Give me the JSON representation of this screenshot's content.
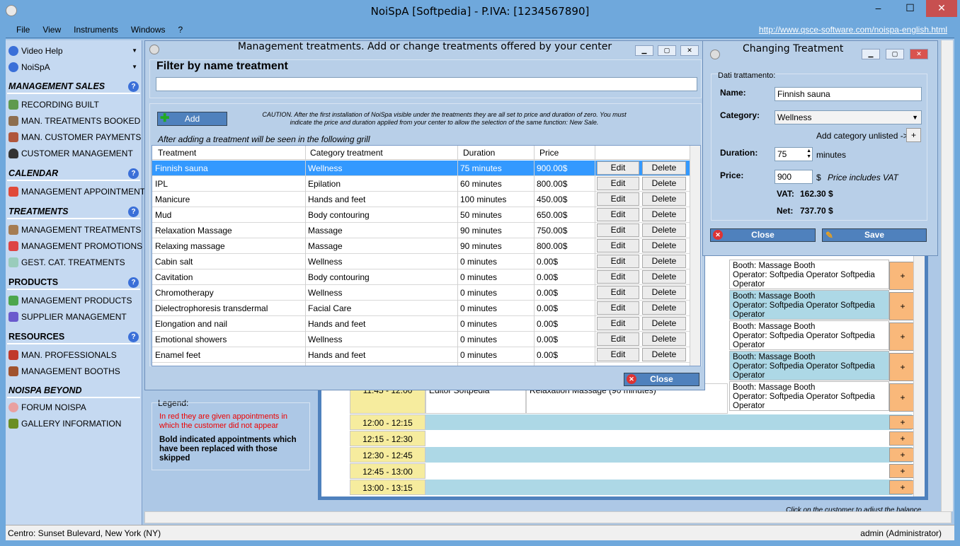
{
  "app": {
    "title": "NoiSpA  [Softpedia] - P.IVA: [1234567890]",
    "menu": [
      "File",
      "View",
      "Instruments",
      "Windows",
      "?"
    ],
    "url": "http://www.qsce-software.com/noispa-english.html",
    "min": "–",
    "max": "☐",
    "close": "✕"
  },
  "sidebar": {
    "top": [
      {
        "label": "Video Help"
      },
      {
        "label": "NoiSpA"
      }
    ],
    "sections": [
      {
        "title": "MANAGEMENT SALES",
        "items": [
          "RECORDING BUILT",
          "MAN. TREATMENTS BOOKED",
          "MAN. CUSTOMER PAYMENTS",
          "CUSTOMER MANAGEMENT"
        ]
      },
      {
        "title": "CALENDAR",
        "items": [
          "MANAGEMENT APPOINTMENTS"
        ]
      },
      {
        "title": "TREATMENTS",
        "items": [
          "MANAGEMENT TREATMENTS",
          "MANAGEMENT PROMOTIONS",
          "GEST. CAT. TREATMENTS"
        ]
      },
      {
        "title": "PRODUCTS",
        "items": [
          "MANAGEMENT PRODUCTS",
          "SUPPLIER MANAGEMENT"
        ]
      },
      {
        "title": "RESOURCES",
        "items": [
          "MAN. PROFESSIONALS",
          "MANAGEMENT BOOTHS"
        ]
      },
      {
        "title": "NOISPA BEYOND",
        "items": [
          "FORUM NOISPA",
          "GALLERY INFORMATION"
        ]
      }
    ],
    "help": "?"
  },
  "legend": {
    "title": "Legend:",
    "red_text": "In red they are given appointments in which the customer did not appear",
    "bold_text": "Bold indicated appointments which have been replaced with those skipped"
  },
  "schedule": {
    "booth_rows": [
      {
        "booth": "Booth: Massage Booth",
        "operator": "Operator: Softpedia Operator Softpedia Operator"
      },
      {
        "booth": "Booth: Massage Booth",
        "operator": "Operator: Softpedia Operator Softpedia Operator"
      },
      {
        "booth": "Booth: Massage Booth",
        "operator": "Operator: Softpedia Operator Softpedia Operator"
      },
      {
        "booth": "Booth: Massage Booth",
        "operator": "Operator: Softpedia Operator Softpedia Operator"
      },
      {
        "booth": "Booth: Massage Booth",
        "operator": "Operator: Softpedia Operator Softpedia Operator"
      }
    ],
    "appointment": {
      "time": "11:45 - 12:00",
      "operator": "Editor Softpedia",
      "treatment": "Relaxation Massage (90 minutes)"
    },
    "times": [
      "12:00 - 12:15",
      "12:15 - 12:30",
      "12:30 - 12:45",
      "12:45 - 13:00",
      "13:00 - 13:15"
    ],
    "plus": "+",
    "hint": "Click on the customer to adjust the balance"
  },
  "treatments_window": {
    "title": "Management treatments. Add or change treatments offered by your center",
    "filter_label": "Filter by name treatment",
    "filter_value": "",
    "add_label": "Add",
    "caution": "CAUTION. After the first installation of NoiSpa visible under the treatments they are all set to price and duration of zero. You must indicate the price and duration applied from your center to allow the selection of the same function: New Sale.",
    "grid_caption": "After adding a treatment will be seen in the following grill",
    "columns": [
      "Treatment",
      "Category treatment",
      "Duration",
      "Price"
    ],
    "edit_label": "Edit",
    "delete_label": "Delete",
    "close_label": "Close",
    "rows": [
      [
        "Finnish sauna",
        "Wellness",
        "75 minutes",
        "900.00$"
      ],
      [
        "IPL",
        "Epilation",
        "60 minutes",
        "800.00$"
      ],
      [
        "Manicure",
        "Hands and feet",
        "100 minutes",
        "450.00$"
      ],
      [
        "Mud",
        "Body contouring",
        "50 minutes",
        "650.00$"
      ],
      [
        "Relaxation Massage",
        "Massage",
        "90 minutes",
        "750.00$"
      ],
      [
        "Relaxing massage",
        "Massage",
        "90 minutes",
        "800.00$"
      ],
      [
        "Cabin salt",
        "Wellness",
        "0 minutes",
        "0.00$"
      ],
      [
        "Cavitation",
        "Body contouring",
        "0 minutes",
        "0.00$"
      ],
      [
        "Chromotherapy",
        "Wellness",
        "0 minutes",
        "0.00$"
      ],
      [
        "Dielectrophoresis transdermal",
        "Facial Care",
        "0 minutes",
        "0.00$"
      ],
      [
        "Elongation and nail",
        "Hands and feet",
        "0 minutes",
        "0.00$"
      ],
      [
        "Emotional showers",
        "Wellness",
        "0 minutes",
        "0.00$"
      ],
      [
        "Enamel feet",
        "Hands and feet",
        "0 minutes",
        "0.00$"
      ]
    ]
  },
  "change_window": {
    "title": "Changing Treatment",
    "group_label": "Dati trattamento:",
    "name_label": "Name:",
    "name_value": "Finnish sauna",
    "category_label": "Category:",
    "category_value": "Wellness",
    "add_category_label": "Add category unlisted ->",
    "add_category_button": "+",
    "duration_label": "Duration:",
    "duration_value": "75",
    "duration_unit": "minutes",
    "price_label": "Price:",
    "price_value": "900",
    "currency": "$",
    "vat_note": "Price includes VAT",
    "vat_label": "VAT:",
    "vat_value": "162.30 $",
    "net_label": "Net:",
    "net_value": "737.70 $",
    "close_label": "Close",
    "save_label": "Save"
  },
  "status": {
    "left": "Centro: Sunset Bulevard,  New York (NY)",
    "right": "admin (Administrator)"
  }
}
